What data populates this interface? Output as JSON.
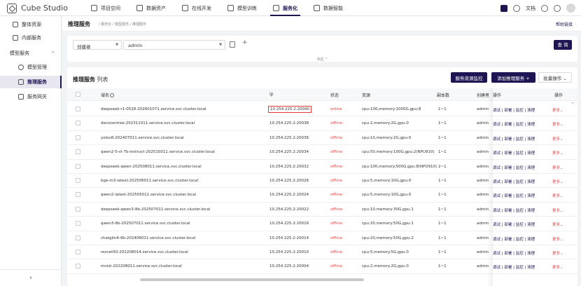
{
  "app": {
    "title": "Cube Studio"
  },
  "topnav": [
    {
      "label": "项目空间",
      "active": false
    },
    {
      "label": "数据资产",
      "active": false
    },
    {
      "label": "在线开发",
      "active": false
    },
    {
      "label": "模型训练",
      "active": false
    },
    {
      "label": "服务化",
      "active": true
    },
    {
      "label": "数据智能",
      "active": false
    }
  ],
  "topright": {
    "docs": "文档",
    "lang_icon": "translate-icon",
    "help_icon": "question-icon"
  },
  "sidebar": {
    "items": [
      {
        "label": "整体资源"
      },
      {
        "label": "内部服务"
      },
      {
        "label": "模型服务"
      },
      {
        "label": "模型管理"
      },
      {
        "label": "推理服务"
      },
      {
        "label": "服务网关"
      }
    ],
    "collapse": "‹"
  },
  "header": {
    "title": "推理服务",
    "breadcrumb": "/ 服务化 / 模型服务 / 推理服务",
    "help": "帮助链接"
  },
  "filter": {
    "field": "创建者",
    "value": "admin",
    "add": "+",
    "search": "查 询",
    "collapse": "收起 ^"
  },
  "list": {
    "title": "推理服务",
    "title_suffix": " 列表",
    "monitor": "服务资源监控",
    "add": "添加推理服务 +",
    "batch": "批量操作 ⌄",
    "columns": {
      "host": "域名",
      "ip": "ip",
      "status": "状态",
      "resource": "资源",
      "replicas": "副本数",
      "creator": "创建者",
      "action": "操作",
      "op": "操作"
    },
    "rows": [
      {
        "host": "deepseek-r1-0528-202601071.service.svc.cluster.local",
        "ip": "10.254.225.2:20040",
        "status": "online",
        "resource": "cpu:100,memory:1000G,gpu:8",
        "replicas": "1~1",
        "creator": "admin",
        "actions": "调试 | 部署 | 监控 | 清理",
        "more": "更多⌄"
      },
      {
        "host": "decisiontree-202311011.service.svc.cluster.local",
        "ip": "10.254.225.2:20038",
        "status": "offline",
        "resource": "cpu:2,memory:2G,gpu:0",
        "replicas": "1~1",
        "creator": "admin",
        "actions": "调试 | 部署 | 监控 | 清理",
        "more": "更多⌄"
      },
      {
        "host": "yolov8-202407011.service.svc.cluster.local",
        "ip": "10.254.225.2:20036",
        "status": "offline",
        "resource": "cpu:10,memory:2G,gpu:0",
        "replicas": "1~1",
        "creator": "admin",
        "actions": "调试 | 部署 | 监控 | 清理",
        "more": "更多⌄"
      },
      {
        "host": "qwen2-5-vl-7b-instruct-202510011.service.svc.cluster.local",
        "ip": "10.254.225.2:20034",
        "status": "offline",
        "resource": "cpu:50,memory:100G,gpu:2(NPU910)",
        "replicas": "1~1",
        "creator": "admin",
        "actions": "调试 | 部署 | 监控 | 清理",
        "more": "更多⌄"
      },
      {
        "host": "deepseek-qwen-202508011.service.svc.cluster.local",
        "ip": "10.254.225.2:20032",
        "status": "offline",
        "resource": "cpu:100,memory:500G,gpu:8(NPU910)",
        "replicas": "2~1",
        "creator": "admin",
        "actions": "调试 | 部署 | 监控 | 清理",
        "more": "更多⌄"
      },
      {
        "host": "bge-m3-latest-202506011.service.svc.cluster.local",
        "ip": "10.254.225.2:20026",
        "status": "offline",
        "resource": "cpu:5,memory:10G,gpu:0",
        "replicas": "1~1",
        "creator": "admin",
        "actions": "调试 | 部署 | 监控 | 清理",
        "more": "更多⌄"
      },
      {
        "host": "qwen2-latest-202505011.service.svc.cluster.local",
        "ip": "10.254.225.2:20024",
        "status": "offline",
        "resource": "cpu:5,memory:10G,gpu:0",
        "replicas": "1~1",
        "creator": "admin",
        "actions": "调试 | 部署 | 监控 | 清理",
        "more": "更多⌄"
      },
      {
        "host": "deepseek-qwen3-8b-202507011.service.svc.cluster.local",
        "ip": "10.254.225.2:20022",
        "status": "offline",
        "resource": "cpu:10,memory:30G,gpu:1",
        "replicas": "1~1",
        "creator": "admin",
        "actions": "调试 | 部署 | 监控 | 清理",
        "more": "更多⌄"
      },
      {
        "host": "qwen3-8b-202507011.service.svc.cluster.local",
        "ip": "10.254.225.2:20016",
        "status": "offline",
        "resource": "cpu:20,memory:50G,gpu:1",
        "replicas": "1~1",
        "creator": "admin",
        "actions": "调试 | 部署 | 监控 | 清理",
        "more": "更多⌄"
      },
      {
        "host": "chatglm4-9b-202406011.service.svc.cluster.local",
        "ip": "10.254.225.2:20014",
        "status": "offline",
        "resource": "cpu:20,memory:50G,gpu:2",
        "replicas": "1~1",
        "creator": "admin",
        "actions": "调试 | 部署 | 监控 | 清理",
        "more": "更多⌄"
      },
      {
        "host": "resnet50-202208014.service.svc.cluster.local",
        "ip": "10.254.225.2:20010",
        "status": "offline",
        "resource": "cpu:5,memory:5G,gpu:0",
        "replicas": "1~1",
        "creator": "admin",
        "actions": "调试 | 部署 | 监控 | 清理",
        "more": "更多⌄"
      },
      {
        "host": "mnist-202208011.service.svc.cluster.local",
        "ip": "10.254.225.2:20004",
        "status": "offline",
        "resource": "cpu:2,memory:2G,gpu:0",
        "replicas": "1~1",
        "creator": "admin",
        "actions": "调试 | 部署 | 监控 | 清理",
        "more": "更多⌄"
      }
    ]
  },
  "colors": {
    "brand": "#1e1653",
    "offline": "#e64545",
    "highlight": "#e23b3b"
  }
}
